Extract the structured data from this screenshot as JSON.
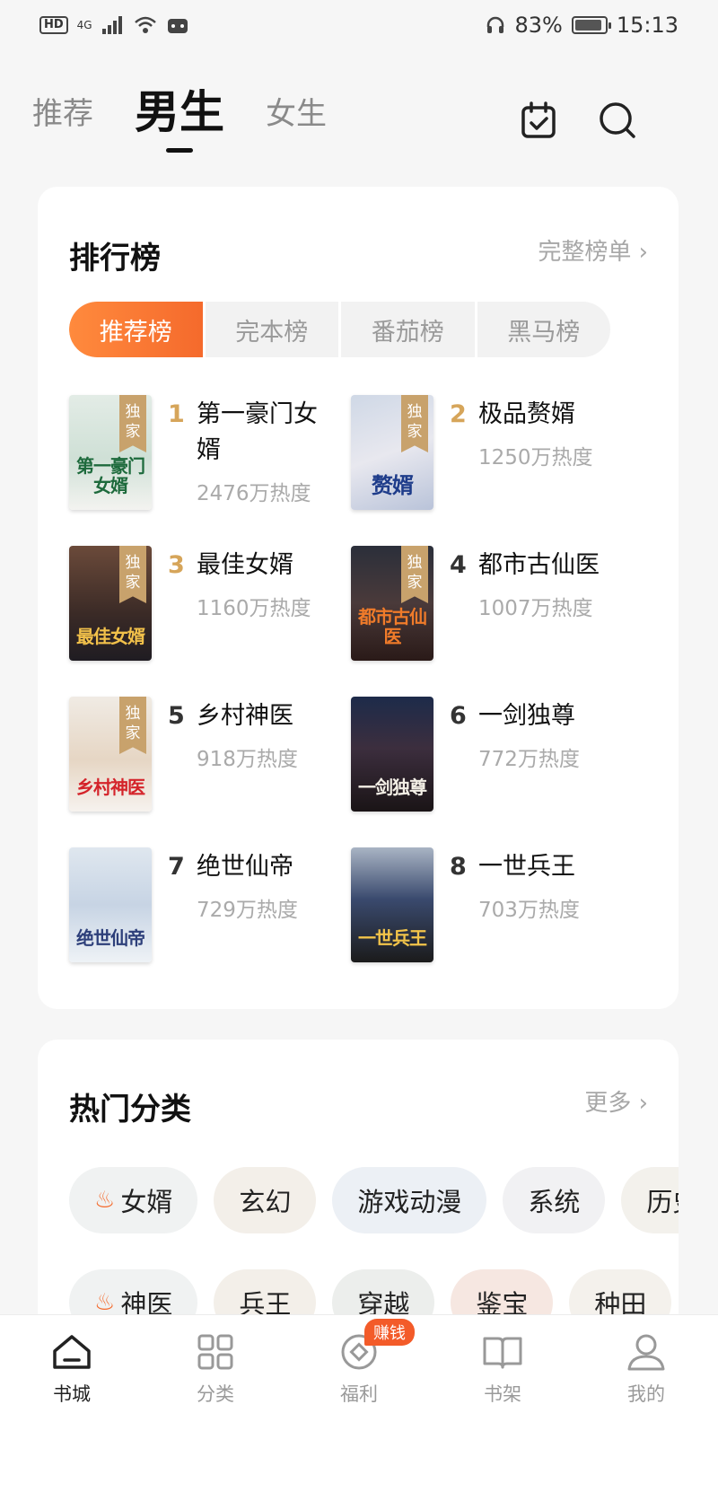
{
  "status_bar": {
    "left": {
      "hd": "HD",
      "network": "4G"
    },
    "battery_percent": "83%",
    "time": "15:13"
  },
  "top_tabs": [
    {
      "label": "推荐",
      "active": false
    },
    {
      "label": "男生",
      "active": true
    },
    {
      "label": "女生",
      "active": false
    }
  ],
  "ranking": {
    "title": "排行榜",
    "more": "完整榜单 ›",
    "tabs": [
      {
        "label": "推荐榜",
        "active": true
      },
      {
        "label": "完本榜",
        "active": false
      },
      {
        "label": "番茄榜",
        "active": false
      },
      {
        "label": "黑马榜",
        "active": false
      }
    ],
    "exclusive_label": [
      "独",
      "家"
    ],
    "books": [
      {
        "rank": "1",
        "title": "第一豪门女婿",
        "heat": "2476万热度",
        "exclusive": true,
        "cover_text": "第一豪门女婿"
      },
      {
        "rank": "2",
        "title": "极品赘婿",
        "heat": "1250万热度",
        "exclusive": true,
        "cover_text": "赘婿"
      },
      {
        "rank": "3",
        "title": "最佳女婿",
        "heat": "1160万热度",
        "exclusive": true,
        "cover_text": "最佳女婿"
      },
      {
        "rank": "4",
        "title": "都市古仙医",
        "heat": "1007万热度",
        "exclusive": true,
        "cover_text": "都市古仙医"
      },
      {
        "rank": "5",
        "title": "乡村神医",
        "heat": "918万热度",
        "exclusive": true,
        "cover_text": "乡村神医"
      },
      {
        "rank": "6",
        "title": "一剑独尊",
        "heat": "772万热度",
        "exclusive": false,
        "cover_text": "一剑独尊"
      },
      {
        "rank": "7",
        "title": "绝世仙帝",
        "heat": "729万热度",
        "exclusive": false,
        "cover_text": "绝世仙帝"
      },
      {
        "rank": "8",
        "title": "一世兵王",
        "heat": "703万热度",
        "exclusive": false,
        "cover_text": "一世兵王"
      }
    ]
  },
  "categories": {
    "title": "热门分类",
    "more": "更多 ›",
    "row1": [
      {
        "label": "女婿",
        "hot": true
      },
      {
        "label": "玄幻",
        "hot": false
      },
      {
        "label": "游戏动漫",
        "hot": false
      },
      {
        "label": "系统",
        "hot": false
      },
      {
        "label": "历史",
        "hot": false
      }
    ],
    "row2": [
      {
        "label": "神医",
        "hot": true
      },
      {
        "label": "兵王",
        "hot": false
      },
      {
        "label": "穿越",
        "hot": false
      },
      {
        "label": "鉴宝",
        "hot": false
      },
      {
        "label": "种田",
        "hot": false
      }
    ]
  },
  "bottom_nav": [
    {
      "label": "书城",
      "icon": "home-icon",
      "active": true
    },
    {
      "label": "分类",
      "icon": "grid-icon",
      "active": false
    },
    {
      "label": "福利",
      "icon": "coin-icon",
      "active": false,
      "badge": "赚钱"
    },
    {
      "label": "书架",
      "icon": "book-icon",
      "active": false
    },
    {
      "label": "我的",
      "icon": "user-icon",
      "active": false
    }
  ],
  "colors": {
    "accent": "#f56a2c",
    "rank_gold": "#d6a55a",
    "exclusive_tag": "#c8a26c"
  }
}
